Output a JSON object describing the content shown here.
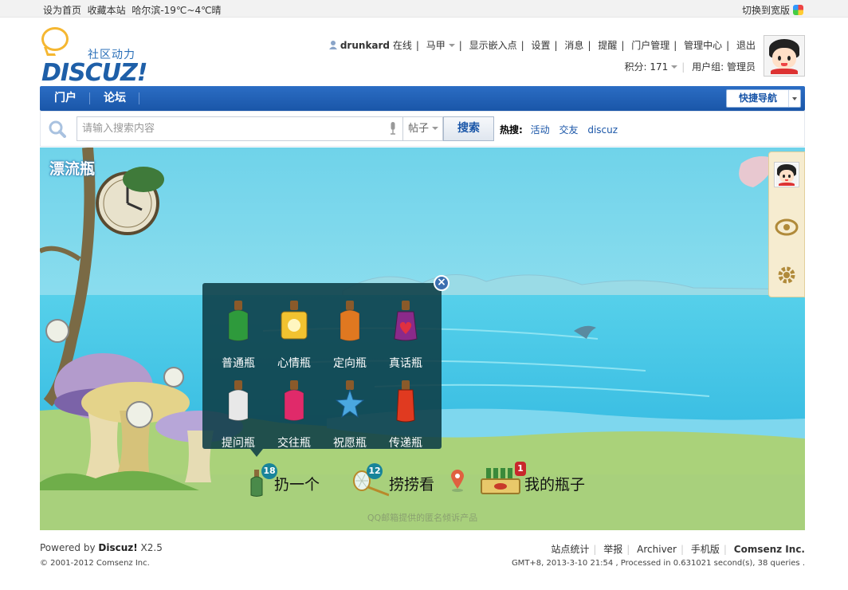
{
  "topbar": {
    "set_home": "设为首页",
    "bookmark": "收藏本站",
    "weather": "哈尔滨-19℃~4℃晴",
    "wide_switch": "切换到宽版",
    "wide_icon": "palette-icon"
  },
  "header": {
    "logo_cn": "社区动力",
    "logo_en": "DISCUZ!",
    "username": "drunkard",
    "online": "在线",
    "vest": "马甲",
    "show_embed": "显示嵌入点",
    "settings": "设置",
    "messages": "消息",
    "remind": "提醒",
    "portal_admin": "门户管理",
    "admin_center": "管理中心",
    "logout": "退出",
    "credits": "积分: 171",
    "usergroup": "用户组: 管理员"
  },
  "nav": {
    "items": [
      {
        "label": "门户"
      },
      {
        "label": "论坛"
      }
    ],
    "quick_nav": "快捷导航"
  },
  "search": {
    "placeholder": "请输入搜索内容",
    "type": "帖子",
    "button": "搜索",
    "hot_label": "热搜:",
    "hot_items": [
      "活动",
      "交友",
      "discuz"
    ]
  },
  "scene": {
    "title": "漂流瓶",
    "credit": "QQ邮箱提供的匿名倾诉产品",
    "bottles": [
      {
        "label": "普通瓶",
        "color": "#2e9a3c"
      },
      {
        "label": "心情瓶",
        "color": "#f2c230"
      },
      {
        "label": "定向瓶",
        "color": "#e07820"
      },
      {
        "label": "真话瓶",
        "color": "#8a2a8a"
      },
      {
        "label": "提问瓶",
        "color": "#e8e8e8"
      },
      {
        "label": "交往瓶",
        "color": "#e02a6a"
      },
      {
        "label": "祝愿瓶",
        "color": "#4aa8e0"
      },
      {
        "label": "传递瓶",
        "color": "#e03a20"
      }
    ],
    "actions": {
      "throw": {
        "label": "扔一个",
        "count": "18"
      },
      "fish": {
        "label": "捞捞看",
        "count": "12"
      },
      "mine": {
        "label": "我的瓶子",
        "count": "1"
      }
    }
  },
  "footer": {
    "powered_prefix": "Powered by ",
    "powered_brand": "Discuz!",
    "powered_ver": " X2.5",
    "copyright": "© 2001-2012 Comsenz Inc.",
    "links": [
      "站点统计",
      "举报",
      "Archiver",
      "手机版"
    ],
    "company": "Comsenz Inc.",
    "stats": "GMT+8, 2013-3-10 21:54 , Processed in 0.631021 second(s), 38 queries ."
  }
}
